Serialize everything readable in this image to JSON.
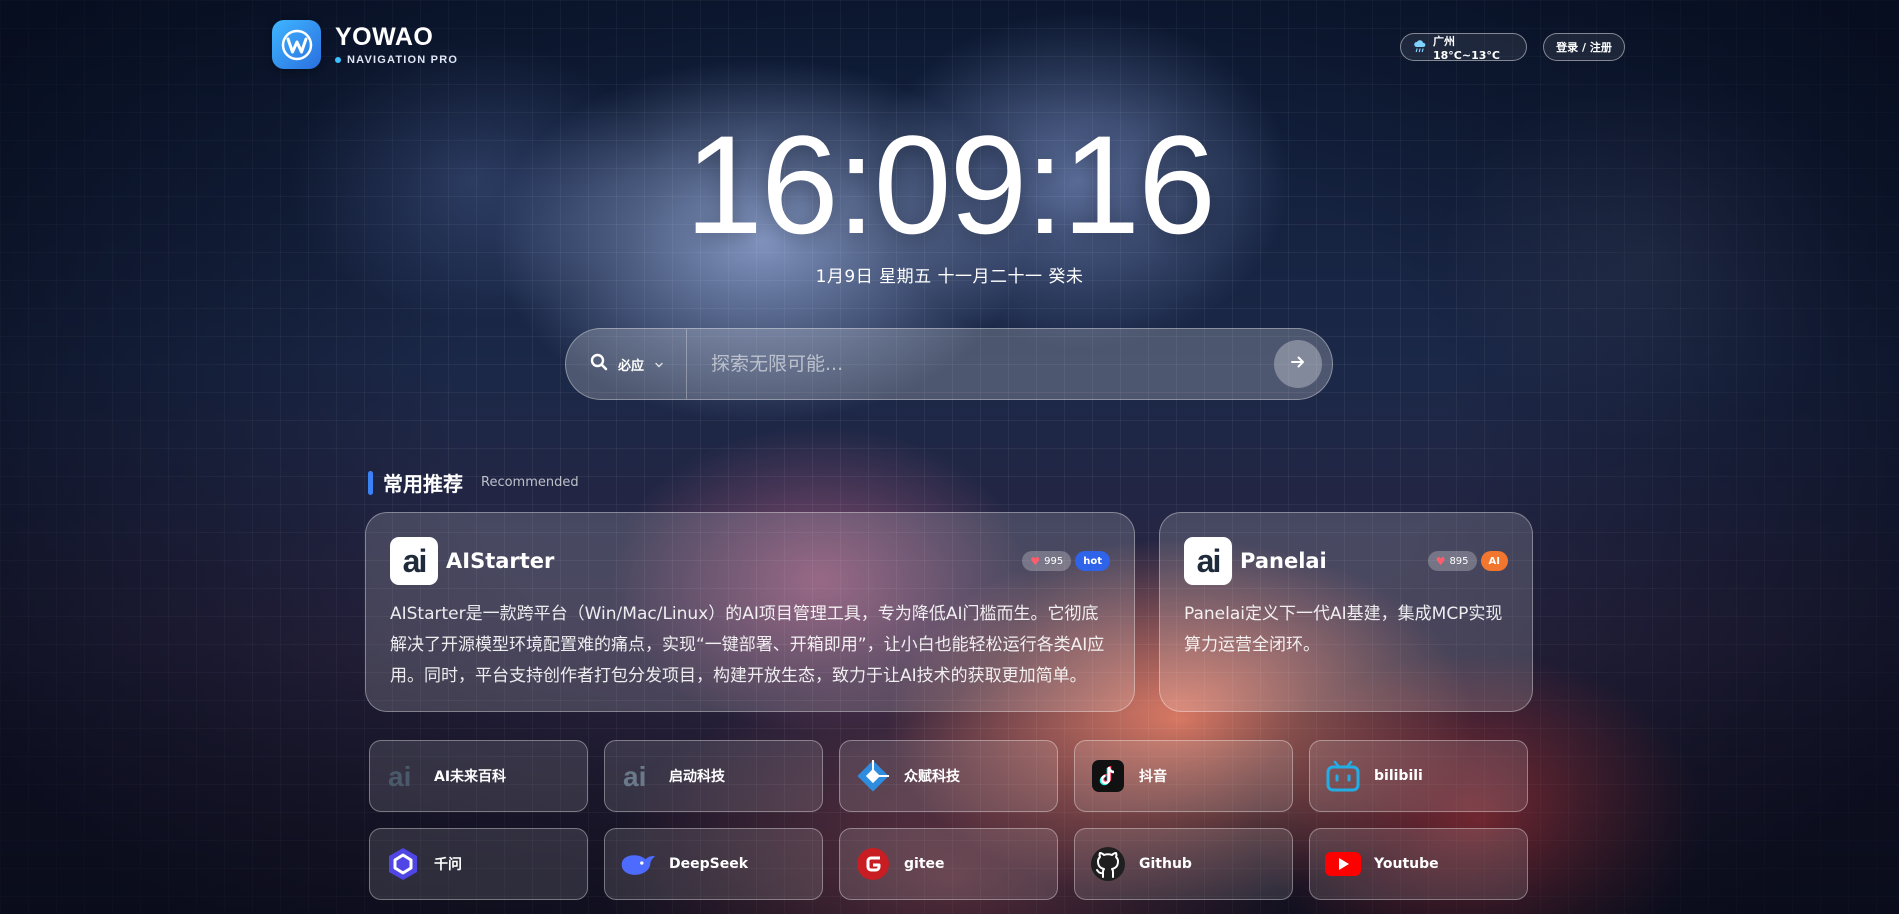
{
  "brand": {
    "name": "YOWAO",
    "subtitle": "NAVIGATION PRO",
    "accent": "#39c2ff"
  },
  "header": {
    "weather": "广州 18°C~13°C",
    "weather_icon": "rain-cloud-icon",
    "login": "登录 / 注册"
  },
  "clock": {
    "time": "16:09:16",
    "date": "1月9日 星期五 十一月二十一 癸未"
  },
  "search": {
    "engine": "必应",
    "placeholder": "探索无限可能..."
  },
  "section": {
    "title": "常用推荐",
    "subtitle": "Recommended"
  },
  "featured": [
    {
      "name": "AIStarter",
      "likes": "995",
      "tag": "hot",
      "tag_color": "#2f63ea",
      "description": "AIStarter是一款跨平台（Win/Mac/Linux）的AI项目管理工具，专为降低AI门槛而生。它彻底解决了开源模型环境配置难的痛点，实现“一键部署、开箱即用”，让小白也能轻松运行各类AI应用。同时，平台支持创作者打包分发项目，构建开放生态，致力于让AI技术的获取更加简单。"
    },
    {
      "name": "Panelai",
      "likes": "895",
      "tag": "AI",
      "tag_color": "#f2762e",
      "description": "Panelai定义下一代AI基建，集成MCP实现算力运营全闭环。"
    }
  ],
  "sites": [
    {
      "label": "AI未来百科",
      "icon": "ai-logo-icon"
    },
    {
      "label": "启动科技",
      "icon": "ai-logo-icon"
    },
    {
      "label": "众赋科技",
      "icon": "diamond-logo-icon"
    },
    {
      "label": "抖音",
      "icon": "tiktok-icon"
    },
    {
      "label": "bilibili",
      "icon": "bilibili-icon"
    },
    {
      "label": "千问",
      "icon": "qwen-icon"
    },
    {
      "label": "DeepSeek",
      "icon": "whale-icon"
    },
    {
      "label": "gitee",
      "icon": "gitee-icon"
    },
    {
      "label": "Github",
      "icon": "github-icon"
    },
    {
      "label": "Youtube",
      "icon": "youtube-icon"
    }
  ]
}
